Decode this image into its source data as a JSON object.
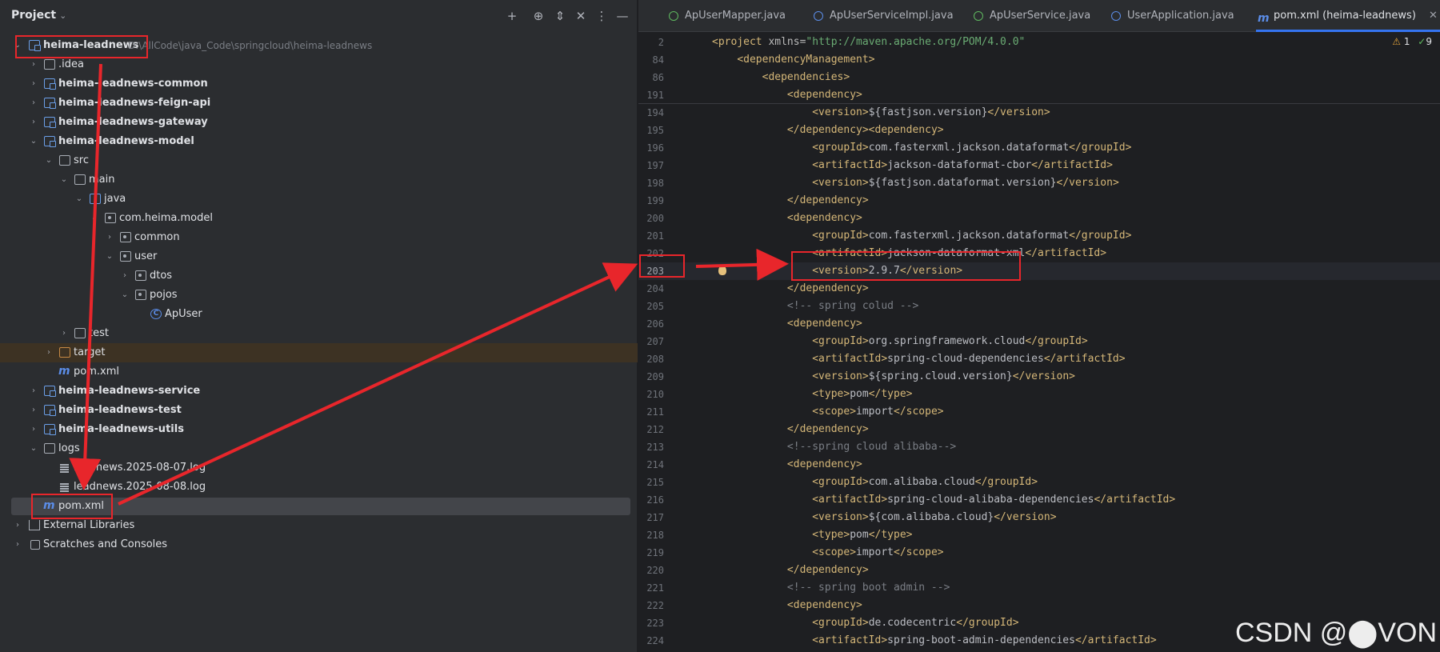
{
  "project_panel": {
    "title": "Project",
    "tree": [
      {
        "label": "heima-leadnews",
        "path": "D:\\AllCode\\java_Code\\springcloud\\heima-leadnews",
        "bold": true
      },
      {
        "label": ".idea"
      },
      {
        "label": "heima-leadnews-common",
        "bold": true
      },
      {
        "label": "heima-leadnews-feign-api",
        "bold": true
      },
      {
        "label": "heima-leadnews-gateway",
        "bold": true
      },
      {
        "label": "heima-leadnews-model",
        "bold": true
      },
      {
        "label": "src"
      },
      {
        "label": "main"
      },
      {
        "label": "java"
      },
      {
        "label": "com.heima.model"
      },
      {
        "label": "common"
      },
      {
        "label": "user"
      },
      {
        "label": "dtos"
      },
      {
        "label": "pojos"
      },
      {
        "label": "ApUser"
      },
      {
        "label": "test"
      },
      {
        "label": "target"
      },
      {
        "label": "pom.xml"
      },
      {
        "label": "heima-leadnews-service",
        "bold": true
      },
      {
        "label": "heima-leadnews-test",
        "bold": true
      },
      {
        "label": "heima-leadnews-utils",
        "bold": true
      },
      {
        "label": "logs"
      },
      {
        "label": "leadnews.2025-08-07.log"
      },
      {
        "label": "leadnews.2025-08-08.log"
      },
      {
        "label": "pom.xml"
      },
      {
        "label": "External Libraries"
      },
      {
        "label": "Scratches and Consoles"
      }
    ]
  },
  "editor": {
    "tabs": [
      {
        "label": "ApUserMapper.java"
      },
      {
        "label": "ApUserServiceImpl.java"
      },
      {
        "label": "ApUserService.java"
      },
      {
        "label": "UserApplication.java"
      },
      {
        "label": "pom.xml (heima-leadnews)",
        "active": true
      }
    ],
    "inspections": {
      "warnings": "1",
      "ok": "9"
    },
    "sticky_lines": [
      {
        "n": "2",
        "indent": "",
        "text": "<project xmlns=\"http://maven.apache.org/POM/4.0.0\""
      },
      {
        "n": "84",
        "indent": "    ",
        "text": "<dependencyManagement>"
      },
      {
        "n": "86",
        "indent": "        ",
        "text": "<dependencies>"
      },
      {
        "n": "191",
        "indent": "            ",
        "text": "<dependency>"
      }
    ],
    "lines": [
      {
        "n": "194",
        "indent": "                ",
        "text": "<version>${fastjson.version}</version>"
      },
      {
        "n": "195",
        "indent": "            ",
        "text": "</dependency><dependency>"
      },
      {
        "n": "196",
        "indent": "                ",
        "text": "<groupId>com.fasterxml.jackson.dataformat</groupId>"
      },
      {
        "n": "197",
        "indent": "                ",
        "text": "<artifactId>jackson-dataformat-cbor</artifactId>"
      },
      {
        "n": "198",
        "indent": "                ",
        "text": "<version>${fastjson.dataformat.version}</version>"
      },
      {
        "n": "199",
        "indent": "            ",
        "text": "</dependency>"
      },
      {
        "n": "200",
        "indent": "            ",
        "text": "<dependency>"
      },
      {
        "n": "201",
        "indent": "                ",
        "text": "<groupId>com.fasterxml.jackson.dataformat</groupId>"
      },
      {
        "n": "202",
        "indent": "                ",
        "text": "<artifactId>jackson-dataformat-xml</artifactId>"
      },
      {
        "n": "203",
        "indent": "                ",
        "text": "<version>2.9.7</version>",
        "current": true
      },
      {
        "n": "204",
        "indent": "            ",
        "text": "</dependency>"
      },
      {
        "n": "205",
        "indent": "            ",
        "text": "<!-- spring colud -->"
      },
      {
        "n": "206",
        "indent": "            ",
        "text": "<dependency>"
      },
      {
        "n": "207",
        "indent": "                ",
        "text": "<groupId>org.springframework.cloud</groupId>"
      },
      {
        "n": "208",
        "indent": "                ",
        "text": "<artifactId>spring-cloud-dependencies</artifactId>"
      },
      {
        "n": "209",
        "indent": "                ",
        "text": "<version>${spring.cloud.version}</version>"
      },
      {
        "n": "210",
        "indent": "                ",
        "text": "<type>pom</type>"
      },
      {
        "n": "211",
        "indent": "                ",
        "text": "<scope>import</scope>"
      },
      {
        "n": "212",
        "indent": "            ",
        "text": "</dependency>"
      },
      {
        "n": "213",
        "indent": "            ",
        "text": "<!--spring cloud alibaba-->"
      },
      {
        "n": "214",
        "indent": "            ",
        "text": "<dependency>"
      },
      {
        "n": "215",
        "indent": "                ",
        "text": "<groupId>com.alibaba.cloud</groupId>"
      },
      {
        "n": "216",
        "indent": "                ",
        "text": "<artifactId>spring-cloud-alibaba-dependencies</artifactId>"
      },
      {
        "n": "217",
        "indent": "                ",
        "text": "<version>${com.alibaba.cloud}</version>"
      },
      {
        "n": "218",
        "indent": "                ",
        "text": "<type>pom</type>"
      },
      {
        "n": "219",
        "indent": "                ",
        "text": "<scope>import</scope>"
      },
      {
        "n": "220",
        "indent": "            ",
        "text": "</dependency>"
      },
      {
        "n": "221",
        "indent": "            ",
        "text": "<!-- spring boot admin -->"
      },
      {
        "n": "222",
        "indent": "            ",
        "text": "<dependency>"
      },
      {
        "n": "223",
        "indent": "                ",
        "text": "<groupId>de.codecentric</groupId>"
      },
      {
        "n": "224",
        "indent": "                ",
        "text": "<artifactId>spring-boot-admin-dependencies</artifactId>"
      }
    ]
  },
  "watermark": "CSDN @⬤VON",
  "colors": {
    "annotation_red": "#e8262b",
    "accent_blue": "#3574f0",
    "xml_tag": "#d5b778",
    "xml_string": "#6aab73",
    "comment": "#7a7e85"
  }
}
